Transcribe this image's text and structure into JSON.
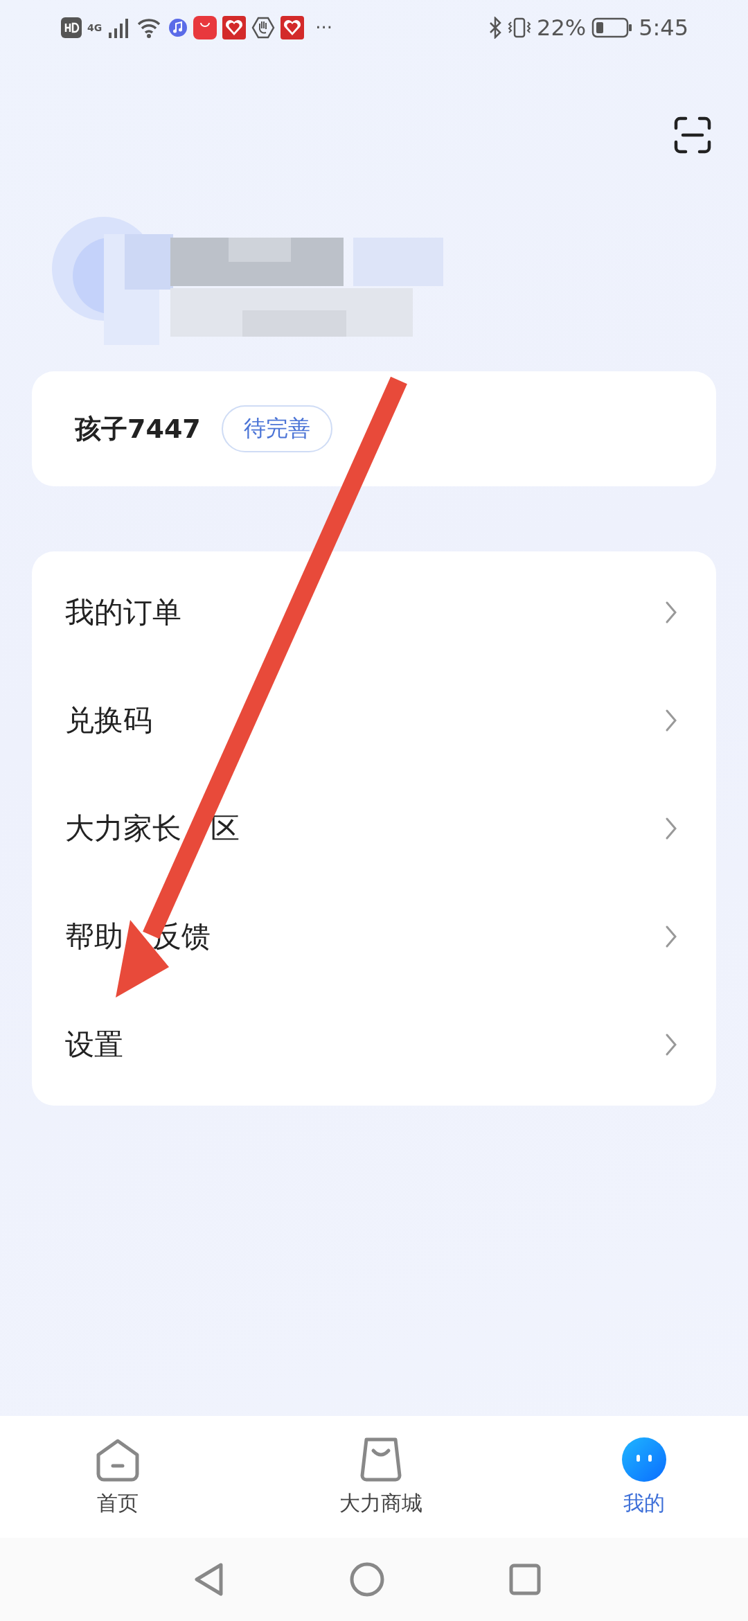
{
  "status_bar": {
    "network": "4G",
    "battery": "22%",
    "time": "5:45",
    "more": "···"
  },
  "profile_card": {
    "name": "孩子7447",
    "badge": "待完善"
  },
  "menu": [
    {
      "label": "我的订单"
    },
    {
      "label": "兑换码"
    },
    {
      "label": "大力家长",
      "label_after": "区"
    },
    {
      "label": "帮助",
      "label_after": "反馈"
    },
    {
      "label": "设置"
    }
  ],
  "tabs": [
    {
      "label": "首页",
      "selected": false
    },
    {
      "label": "大力商城",
      "selected": false
    },
    {
      "label": "我的",
      "selected": true
    }
  ]
}
